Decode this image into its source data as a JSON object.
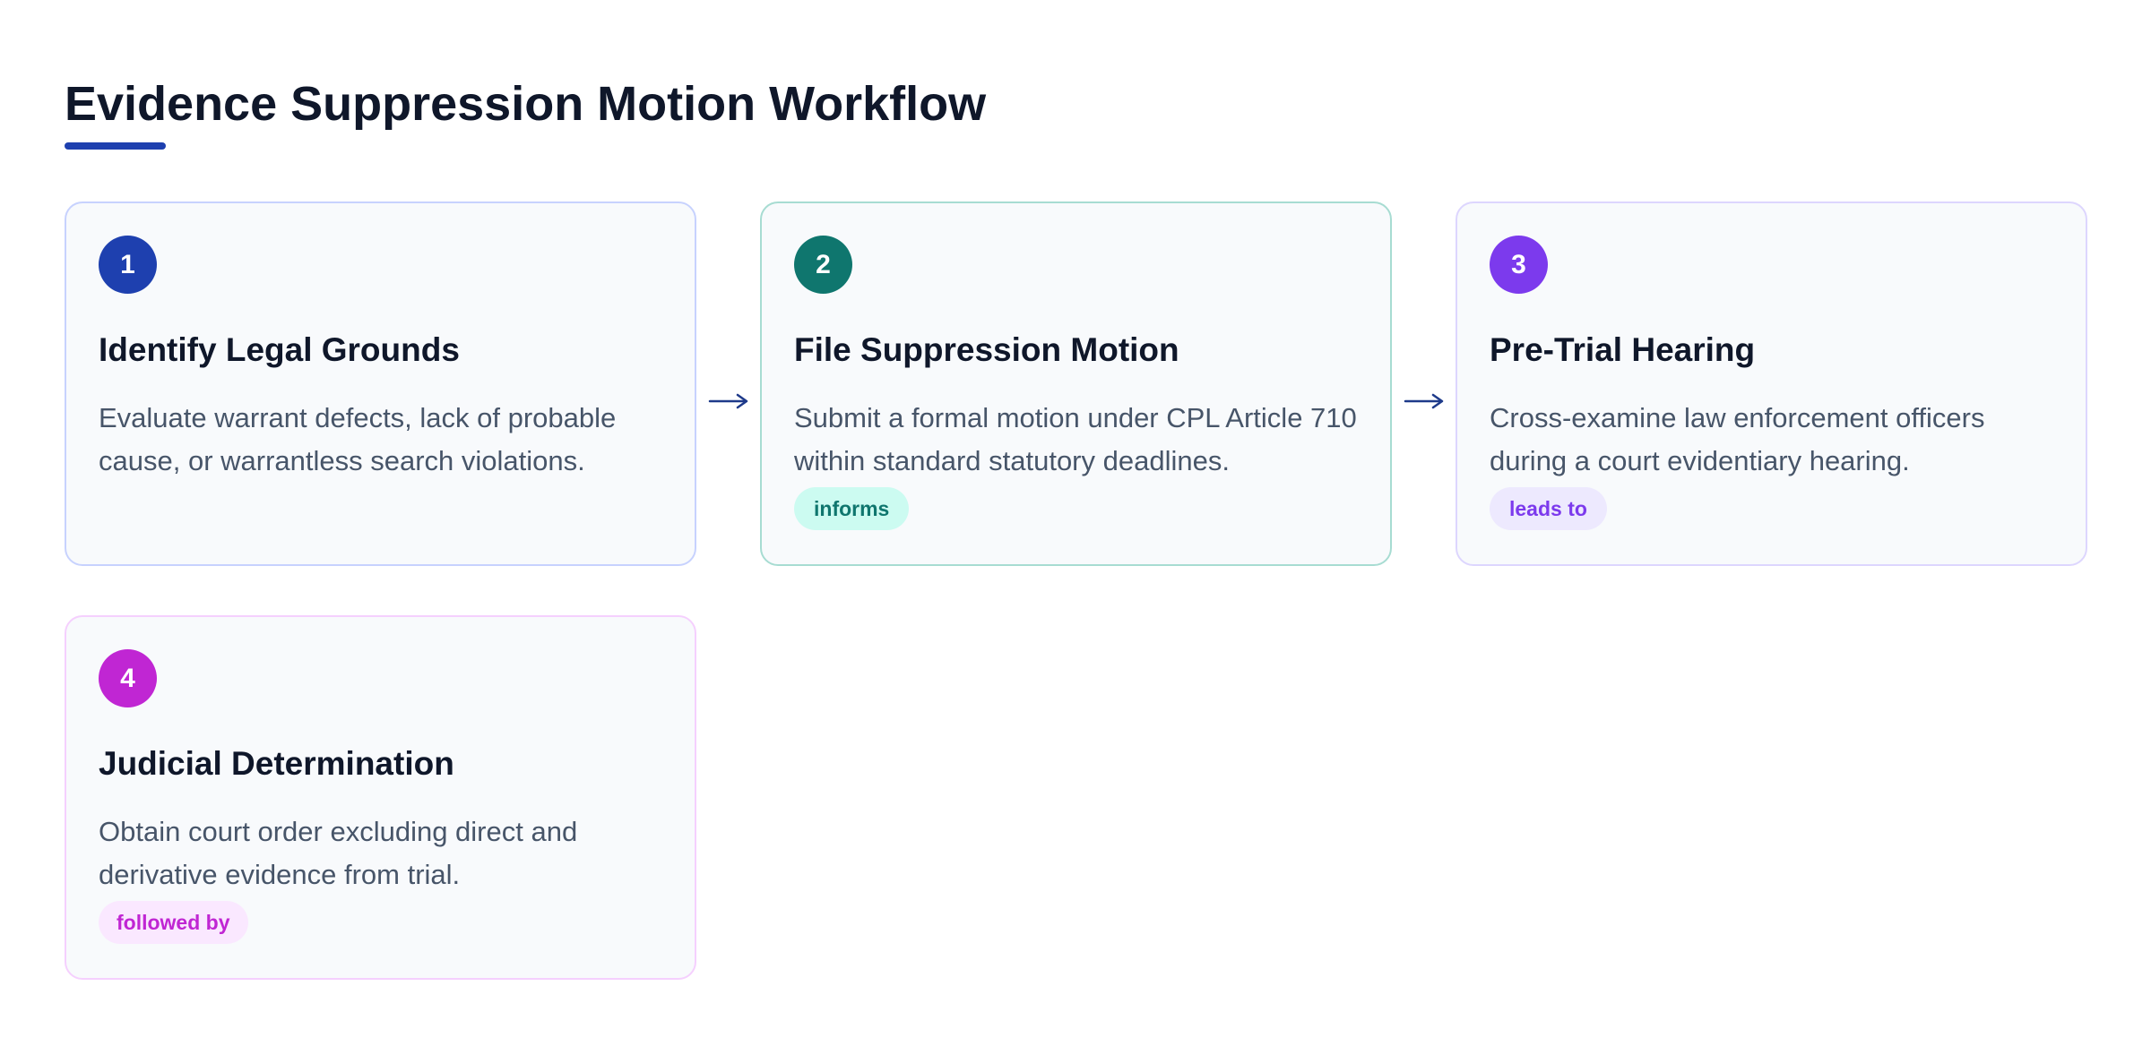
{
  "title": "Evidence Suppression Motion Workflow",
  "accent_color": "#1e40af",
  "connector": {
    "icon": "arrow-right-icon",
    "color": "#1e3a8a"
  },
  "steps": [
    {
      "number": "1",
      "title": "Identify Legal Grounds",
      "description": "Evaluate warrant defects, lack of probable cause, or warrantless search violations.",
      "badge": null,
      "color": "#1e40af",
      "border_color": "#c7d2fe",
      "badge_bg": null
    },
    {
      "number": "2",
      "title": "File Suppression Motion",
      "description": "Submit a formal motion under CPL Article 710 within standard statutory deadlines.",
      "badge": "informs",
      "color": "#0f766e",
      "border_color": "#a7dcd2",
      "badge_bg": "#ccfbf1"
    },
    {
      "number": "3",
      "title": "Pre-Trial Hearing",
      "description": "Cross-examine law enforcement officers during a court evidentiary hearing.",
      "badge": "leads to",
      "color": "#7c3aed",
      "border_color": "#ddd6fe",
      "badge_bg": "#ede9fe"
    },
    {
      "number": "4",
      "title": "Judicial Determination",
      "description": "Obtain court order excluding direct and derivative evidence from trial.",
      "badge": "followed by",
      "color": "#c026d3",
      "border_color": "#f5d0fe",
      "badge_bg": "#fae8ff"
    }
  ]
}
